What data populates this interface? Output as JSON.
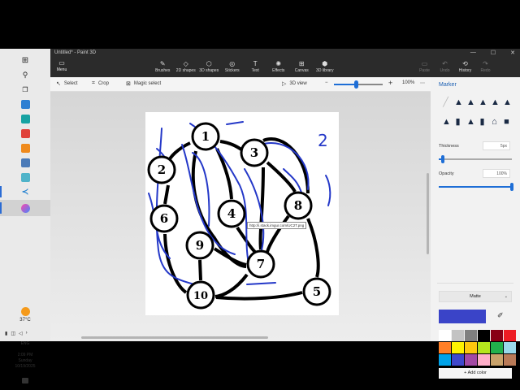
{
  "window": {
    "title": "Untitled* - Paint 3D",
    "menu_label": "Menu",
    "controls": [
      "—",
      "☐",
      "✕"
    ]
  },
  "toolbar": {
    "tools": [
      {
        "label": "Brushes",
        "icon": "brush-icon",
        "glyph": "✎"
      },
      {
        "label": "2D shapes",
        "icon": "2d-shapes-icon",
        "glyph": "◇"
      },
      {
        "label": "3D shapes",
        "icon": "3d-shapes-icon",
        "glyph": "⬡"
      },
      {
        "label": "Stickers",
        "icon": "stickers-icon",
        "glyph": "◎"
      },
      {
        "label": "Text",
        "icon": "text-icon",
        "glyph": "T"
      },
      {
        "label": "Effects",
        "icon": "effects-icon",
        "glyph": "✺"
      },
      {
        "label": "Canvas",
        "icon": "canvas-icon",
        "glyph": "⊞"
      },
      {
        "label": "3D library",
        "icon": "3d-library-icon",
        "glyph": "⬢"
      }
    ],
    "right": [
      {
        "label": "Paste",
        "icon": "paste-icon",
        "glyph": "▭",
        "enabled": false
      },
      {
        "label": "Undo",
        "icon": "undo-icon",
        "glyph": "↶",
        "enabled": false
      },
      {
        "label": "History",
        "icon": "history-icon",
        "glyph": "⟲",
        "enabled": true
      },
      {
        "label": "Redo",
        "icon": "redo-icon",
        "glyph": "↷",
        "enabled": false
      }
    ]
  },
  "subbar": {
    "select_label": "Select",
    "crop_label": "Crop",
    "magic_select_label": "Magic select",
    "view_label": "3D view",
    "zoom_value": "100%",
    "zoom_fraction": 0.45
  },
  "canvas": {
    "tooltip": "http://i.stack.imgur.com/UC2T.png",
    "nodes": [
      {
        "label": "1"
      },
      {
        "label": "2"
      },
      {
        "label": "3"
      },
      {
        "label": "4"
      },
      {
        "label": "5"
      },
      {
        "label": "6"
      },
      {
        "label": "7"
      },
      {
        "label": "8"
      },
      {
        "label": "9"
      },
      {
        "label": "10"
      }
    ],
    "annotation_text": "2",
    "ink_color": "#2438c8"
  },
  "panel": {
    "title": "Marker",
    "thickness_label": "Thickness",
    "thickness_value": "5px",
    "thickness_fraction": 0.05,
    "opacity_label": "Opacity",
    "opacity_value": "100%",
    "opacity_fraction": 1.0,
    "finish": "Matte",
    "current_color": "#3a44c8",
    "palette": [
      "#ffffff",
      "#c3c3c3",
      "#7f7f7f",
      "#000000",
      "#880015",
      "#ed1c24",
      "#ff7f27",
      "#fff200",
      "#ffc90e",
      "#b5e61d",
      "#22b14c",
      "#99d9ea",
      "#00a2e8",
      "#3f48cc",
      "#a349a4",
      "#ffaec9",
      "#c8a26a",
      "#b97a57"
    ],
    "add_color_label": "Add color"
  },
  "taskbar": {
    "weather_temp": "37°C",
    "language": "ENG",
    "time": "2:09 PM",
    "day": "Sunday",
    "date": "10/19/2025"
  }
}
